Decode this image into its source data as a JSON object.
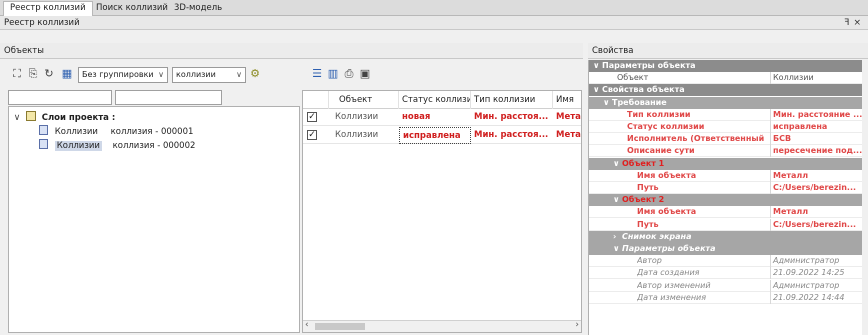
{
  "tabs": [
    {
      "label": "Реестр коллизий",
      "active": true
    },
    {
      "label": "Поиск коллизий",
      "active": false
    },
    {
      "label": "3D-модель",
      "active": false
    }
  ],
  "window": {
    "title": "Реестр коллизий",
    "pin_icon": "pin-icon",
    "close_icon": "close-icon"
  },
  "objects_panel": {
    "title": "Объекты",
    "grouping_select": "Без группировки",
    "collisions_select": "коллизии",
    "tree": {
      "root_label": "Слои проекта :",
      "items": [
        {
          "type": "Коллизии",
          "name": "коллизия - 000001",
          "selected": false
        },
        {
          "type": "Коллизии",
          "name": "коллизия - 000002",
          "selected": true
        }
      ]
    }
  },
  "grid": {
    "columns": [
      "Объект",
      "Статус коллизии",
      "Тип коллизии",
      "Имя"
    ],
    "rows": [
      {
        "checked": true,
        "object": "Коллизии",
        "status": "новая",
        "type": "Мин. расстоя...",
        "name": "Мета"
      },
      {
        "checked": true,
        "object": "Коллизии",
        "status": "исправлена",
        "type": "Мин. расстоя...",
        "name": "Мета"
      }
    ]
  },
  "properties": {
    "title": "Свойства",
    "rows": [
      {
        "kind": "cat",
        "indent": 0,
        "name": "Параметры объекта"
      },
      {
        "kind": "item",
        "indent": 1,
        "name": "Объект",
        "value": "Коллизии",
        "style": "normal"
      },
      {
        "kind": "cat",
        "indent": 0,
        "name": "Свойства объекта"
      },
      {
        "kind": "sub",
        "indent": 1,
        "name": "Требование"
      },
      {
        "kind": "item",
        "indent": 2,
        "name": "Тип коллизии",
        "value": "Мин. расстояние ...",
        "style": "red"
      },
      {
        "kind": "item",
        "indent": 2,
        "name": "Статус коллизии",
        "value": "исправлена",
        "style": "red"
      },
      {
        "kind": "item",
        "indent": 2,
        "name": "Исполнитель (Ответственный)",
        "value": "БСВ",
        "style": "red"
      },
      {
        "kind": "item",
        "indent": 2,
        "name": "Описание сути",
        "value": "пересечение под...",
        "style": "red"
      },
      {
        "kind": "sub-red",
        "indent": 2,
        "name": "Объект 1"
      },
      {
        "kind": "item",
        "indent": 3,
        "name": "Имя объекта",
        "value": "Металл",
        "style": "red"
      },
      {
        "kind": "item",
        "indent": 3,
        "name": "Путь",
        "value": "C:/Users/berezin...",
        "style": "red"
      },
      {
        "kind": "sub-red",
        "indent": 2,
        "name": "Объект 2"
      },
      {
        "kind": "item",
        "indent": 3,
        "name": "Имя объекта",
        "value": "Металл",
        "style": "red"
      },
      {
        "kind": "item",
        "indent": 3,
        "name": "Путь",
        "value": "C:/Users/berezin...",
        "style": "red"
      },
      {
        "kind": "sub-collapsed",
        "indent": 2,
        "name": "Снимок экрана"
      },
      {
        "kind": "sub-italic",
        "indent": 2,
        "name": "Параметры объекта"
      },
      {
        "kind": "item",
        "indent": 3,
        "name": "Автор",
        "value": "Администратор",
        "style": "italic"
      },
      {
        "kind": "item",
        "indent": 3,
        "name": "Дата создания",
        "value": "21.09.2022 14:25",
        "style": "italic"
      },
      {
        "kind": "item",
        "indent": 3,
        "name": "Автор изменений",
        "value": "Администратор",
        "style": "italic"
      },
      {
        "kind": "item",
        "indent": 3,
        "name": "Дата изменения",
        "value": "21.09.2022 14:44",
        "style": "italic"
      }
    ]
  }
}
